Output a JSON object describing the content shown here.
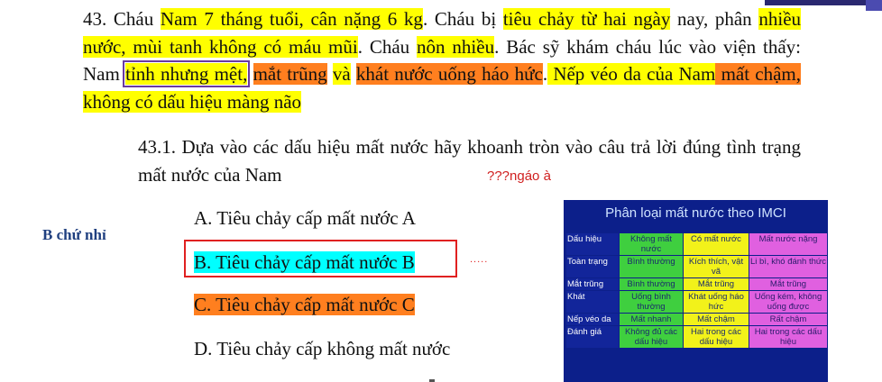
{
  "paragraph": {
    "s01": "43. Cháu ",
    "s02": "Nam 7 tháng tuổi, cân nặng 6 kg",
    "s03": ". Cháu bị ",
    "s04": "tiêu chảy từ hai ngày",
    "s05": " nay, phân ",
    "s06": "nhiều nước, mùi tanh không có máu mũi",
    "s07": ". Cháu ",
    "s08": "nôn nhiều",
    "s09": ". Bác sỹ khám cháu lúc vào viện thấy: Nam ",
    "s10": "tỉnh nhưng mệt,",
    "s11": " ",
    "s12": "mắt trũng",
    "s13": " ",
    "s14": "và",
    "s15": " ",
    "s16": "khát nước uống háo hức",
    "s17": ".",
    "s18": " Nếp véo da của Nam",
    "s19": " mất chậm,",
    "s20": " không có dấu hiệu màng não"
  },
  "question": {
    "text": "43.1. Dựa vào các dấu hiệu mất nước hãy khoanh tròn vào câu trả lời đúng tình trạng mất nước của Nam",
    "note": "???ngáo à",
    "side_note": "B chứ nhỉ",
    "options": {
      "a": "A. Tiêu chảy cấp mất nước A",
      "b": "B. Tiêu chảy cấp mất nước B",
      "c": "C. Tiêu chảy cấp mất nước C",
      "d": "D. Tiêu chảy cấp không mất nước"
    },
    "selected": "b",
    "dots": "....."
  },
  "imci": {
    "title": "Phân loại mất nước theo IMCI",
    "rows": [
      [
        "Dấu hiệu",
        "Không mất nước",
        "Có mất nước",
        "Mất nước nặng"
      ],
      [
        "Toàn trạng",
        "Bình thường",
        "Kích thích, vật vã",
        "Li bì, khó đánh thức"
      ],
      [
        "Mắt trũng",
        "Bình thường",
        "Mắt trũng",
        "Mắt trũng"
      ],
      [
        "Khát",
        "Uống bình thường",
        "Khát uống háo hức",
        "Uống kém, không uống được"
      ],
      [
        "Nếp véo da",
        "Mất nhanh",
        "Mất chậm",
        "Rất chậm"
      ],
      [
        "Đánh giá",
        "Không đủ các dấu hiệu",
        "Hai trong các dấu hiệu",
        "Hai trong các dấu hiệu"
      ]
    ]
  },
  "colors": {
    "yellow_highlight": "#ffff00",
    "orange_highlight": "#ff7f1f",
    "cyan_highlight": "#00ffff",
    "red_box": "#e02020",
    "table_bg": "#0c1f8a"
  }
}
